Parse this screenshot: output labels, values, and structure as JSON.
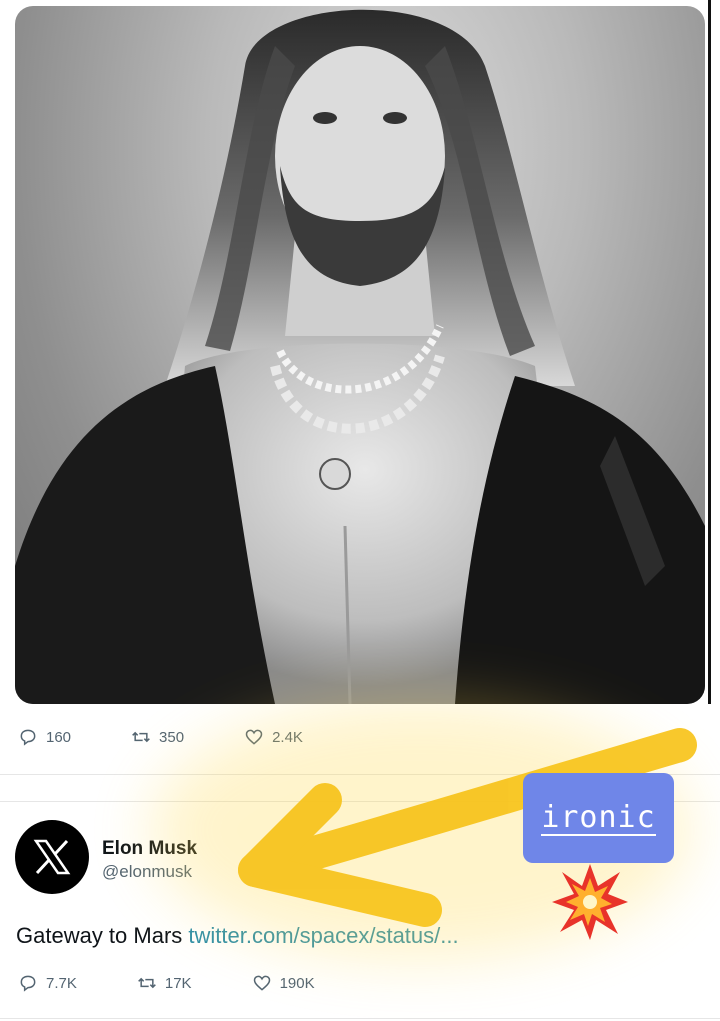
{
  "post1": {
    "image_alt": "Black and white portrait of a long-haired bearded man wearing necklaces and an open leather jacket",
    "actions": {
      "replies": "160",
      "reposts": "350",
      "likes": "2.4K"
    }
  },
  "post2": {
    "author": {
      "name": "Elon Musk",
      "handle": "@elonmusk"
    },
    "text": "Gateway to Mars ",
    "link": "twitter.com/spacex/status/...",
    "actions": {
      "replies": "7.7K",
      "reposts": "17K",
      "likes": "190K"
    }
  },
  "annotation": {
    "sticker_text": "ironic",
    "arrow_color": "#f7c31a",
    "sticker_color": "#6f86e8"
  },
  "colors": {
    "text_primary": "#0f1419",
    "text_secondary": "#536471",
    "link": "#2f8fa8"
  }
}
